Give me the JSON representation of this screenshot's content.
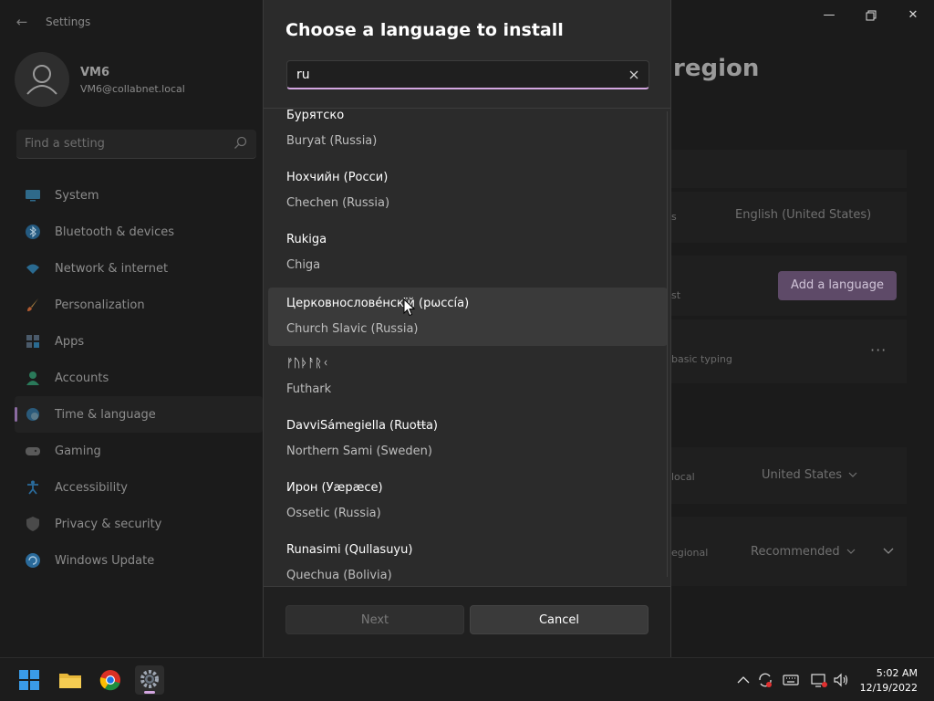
{
  "settings": {
    "app_title": "Settings",
    "user": {
      "name": "VM6",
      "email": "VM6@collabnet.local"
    },
    "search_placeholder": "Find a setting",
    "nav": [
      {
        "label": "System",
        "icon": "monitor-icon"
      },
      {
        "label": "Bluetooth & devices",
        "icon": "bluetooth-icon"
      },
      {
        "label": "Network & internet",
        "icon": "wifi-icon"
      },
      {
        "label": "Personalization",
        "icon": "brush-icon"
      },
      {
        "label": "Apps",
        "icon": "apps-icon"
      },
      {
        "label": "Accounts",
        "icon": "person-icon"
      },
      {
        "label": "Time & language",
        "icon": "globe-clock-icon",
        "active": true
      },
      {
        "label": "Gaming",
        "icon": "gamepad-icon"
      },
      {
        "label": "Accessibility",
        "icon": "accessibility-icon"
      },
      {
        "label": "Privacy & security",
        "icon": "shield-icon"
      },
      {
        "label": "Windows Update",
        "icon": "update-icon"
      }
    ],
    "page_title_fragment": "region",
    "bg": {
      "display_lang_suffix": "s",
      "display_lang_value": "English (United States)",
      "pref_suffix": "st",
      "add_language": "Add a language",
      "basic_typing": "basic typing",
      "country_suffix": "local",
      "country_value": "United States",
      "regional_suffix": "egional",
      "regional_value": "Recommended",
      "more": "···"
    }
  },
  "dialog": {
    "title": "Choose a language to install",
    "search_value": "ru",
    "languages": [
      {
        "native": "Бурятско",
        "english": "Buryat (Russia)"
      },
      {
        "native": "Нохчийн (Росси)",
        "english": "Chechen (Russia)"
      },
      {
        "native": "Rukiga",
        "english": "Chiga"
      },
      {
        "native": "Церковнослове́нскїй (рѡссі́а)",
        "english": "Church Slavic (Russia)",
        "hover": true
      },
      {
        "native": "ᚠᚢᚦᚨᚱᚲ",
        "english": "Futhark"
      },
      {
        "native": "DavviSámegiella (Ruoŧŧa)",
        "english": "Northern Sami (Sweden)"
      },
      {
        "native": "Ирон (Уæрæсе)",
        "english": "Ossetic (Russia)"
      },
      {
        "native": "Runasimi (Qullasuyu)",
        "english": "Quechua (Bolivia)"
      }
    ],
    "next_label": "Next",
    "cancel_label": "Cancel"
  },
  "taskbar": {
    "apps": [
      "start-icon",
      "file-explorer-icon",
      "chrome-icon",
      "settings-icon"
    ],
    "time": "5:02 AM",
    "date": "12/19/2022"
  },
  "colors": {
    "accent": "#d3a6e0",
    "dialog_bg": "#2b2b2b",
    "hover_bg": "#3a3a3a"
  }
}
